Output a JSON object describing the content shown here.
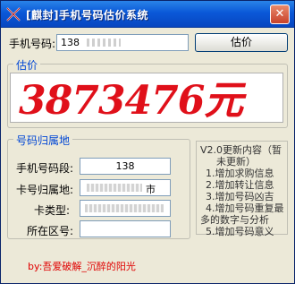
{
  "window": {
    "title": "[麒封]手机号码估价系统",
    "close_symbol": "✕"
  },
  "query": {
    "phone_label": "手机号码:",
    "phone_value": "138 ",
    "estimate_button": "估价"
  },
  "price": {
    "group_title": "估价",
    "value": "3873476元"
  },
  "attribution": {
    "group_title": "号码归属地",
    "segment_label": "手机号码段:",
    "segment_value": "138",
    "location_label": "卡号归属地:",
    "location_value": "市",
    "card_type_label": "卡类型:",
    "card_type_value": "",
    "area_code_label": "所在区号:",
    "area_code_value": ""
  },
  "update_notes": {
    "title_line1": "V2.0更新内容（暂",
    "title_line2": "未更新）",
    "items": [
      "1.增加求购信息",
      "2.增加转让信息",
      "3.增加号码凶吉",
      "4.增加号码重复最",
      "多的数字与分析",
      "5.增加号码意义"
    ]
  },
  "footer": {
    "credit": "by:吾爱破解_沉醉的阳光"
  },
  "colors": {
    "title_bar": "#0a58d8",
    "price_text": "#e0101a",
    "group_title": "#0046d5",
    "credit_text": "#e00000"
  },
  "icons": {
    "app_icon": "crossed-swords-icon",
    "close_icon": "close-icon"
  }
}
